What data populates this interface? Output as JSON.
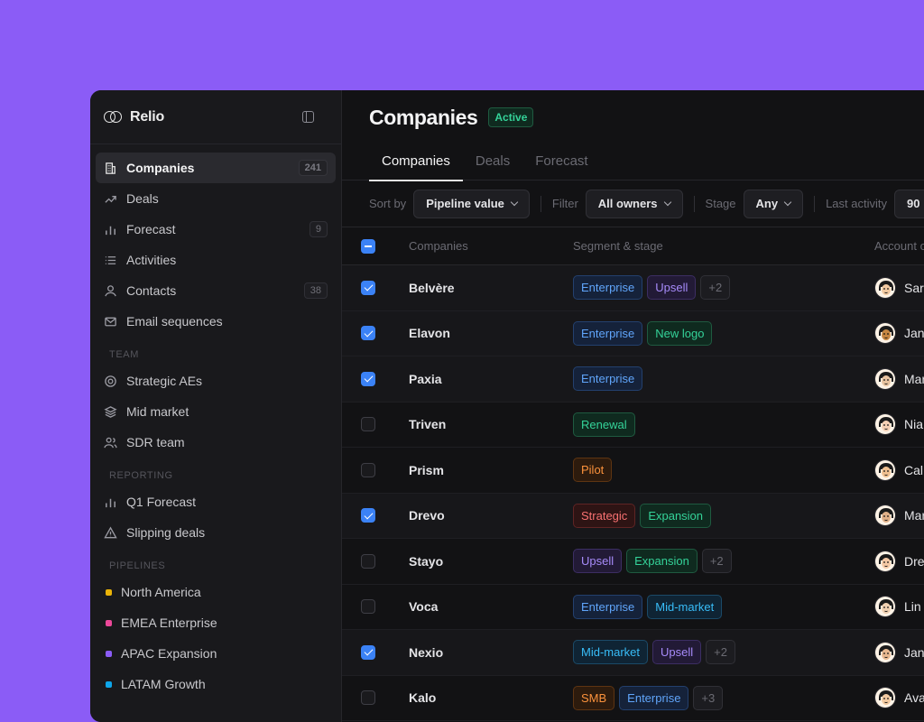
{
  "app": {
    "name": "Relio"
  },
  "sidebar": {
    "items": [
      {
        "label": "Companies",
        "badge": "241",
        "icon": "building-icon",
        "active": true
      },
      {
        "label": "Deals",
        "badge": "",
        "icon": "trend-icon"
      },
      {
        "label": "Forecast",
        "badge": "9",
        "icon": "bar-chart-icon"
      },
      {
        "label": "Activities",
        "badge": "",
        "icon": "list-icon"
      },
      {
        "label": "Contacts",
        "badge": "38",
        "icon": "user-icon"
      },
      {
        "label": "Email sequences",
        "badge": "",
        "icon": "mail-icon"
      }
    ],
    "team_label": "TEAM",
    "team": [
      {
        "label": "Strategic AEs",
        "icon": "target-icon"
      },
      {
        "label": "Mid market",
        "icon": "layers-icon"
      },
      {
        "label": "SDR team",
        "icon": "users-icon"
      }
    ],
    "reporting_label": "REPORTING",
    "reporting": [
      {
        "label": "Q1 Forecast",
        "icon": "bar-chart-icon"
      },
      {
        "label": "Slipping deals",
        "icon": "warning-icon"
      }
    ],
    "pipelines_label": "PIPELINES",
    "pipelines": [
      {
        "label": "North America",
        "color": "#eab308"
      },
      {
        "label": "EMEA Enterprise",
        "color": "#ec4899"
      },
      {
        "label": "APAC Expansion",
        "color": "#8b5cf6"
      },
      {
        "label": "LATAM Growth",
        "color": "#0ea5e9"
      }
    ]
  },
  "header": {
    "title": "Companies",
    "status": "Active"
  },
  "tabs": [
    "Companies",
    "Deals",
    "Forecast"
  ],
  "filters": {
    "sort_label": "Sort by",
    "sort_value": "Pipeline value",
    "filter_label": "Filter",
    "filter_value": "All owners",
    "stage_label": "Stage",
    "stage_value": "Any",
    "activity_label": "Last activity",
    "activity_value": "90"
  },
  "table": {
    "columns": [
      "Companies",
      "Segment & stage",
      "Account o"
    ],
    "rows": [
      {
        "name": "Belvère",
        "checked": true,
        "tags": [
          [
            "Enterprise",
            "blue"
          ],
          [
            "Upsell",
            "purple"
          ],
          [
            "+2",
            "more"
          ]
        ],
        "owner": "Sar",
        "skin": "#f2c9a0"
      },
      {
        "name": "Elavon",
        "checked": true,
        "tags": [
          [
            "Enterprise",
            "blue"
          ],
          [
            "New logo",
            "green"
          ]
        ],
        "owner": "Jan",
        "skin": "#c68642"
      },
      {
        "name": "Paxia",
        "checked": true,
        "tags": [
          [
            "Enterprise",
            "blue"
          ]
        ],
        "owner": "Mar",
        "skin": "#e8c3a0"
      },
      {
        "name": "Triven",
        "checked": false,
        "tags": [
          [
            "Renewal",
            "green"
          ]
        ],
        "owner": "Nia",
        "skin": "#f5d0b5"
      },
      {
        "name": "Prism",
        "checked": false,
        "tags": [
          [
            "Pilot",
            "orange"
          ]
        ],
        "owner": "Cal",
        "skin": "#f0c090"
      },
      {
        "name": "Drevo",
        "checked": true,
        "tags": [
          [
            "Strategic",
            "red"
          ],
          [
            "Expansion",
            "green"
          ]
        ],
        "owner": "Mar",
        "skin": "#e0b088"
      },
      {
        "name": "Stayo",
        "checked": false,
        "tags": [
          [
            "Upsell",
            "purple"
          ],
          [
            "Expansion",
            "green"
          ],
          [
            "+2",
            "more"
          ]
        ],
        "owner": "Dre",
        "skin": "#f5c9a5"
      },
      {
        "name": "Voca",
        "checked": false,
        "tags": [
          [
            "Enterprise",
            "blue"
          ],
          [
            "Mid-market",
            "cyan"
          ]
        ],
        "owner": "Lin",
        "skin": "#f0d0b0"
      },
      {
        "name": "Nexio",
        "checked": true,
        "tags": [
          [
            "Mid-market",
            "cyan"
          ],
          [
            "Upsell",
            "purple"
          ],
          [
            "+2",
            "more"
          ]
        ],
        "owner": "Jan",
        "skin": "#e8b890"
      },
      {
        "name": "Kalo",
        "checked": false,
        "tags": [
          [
            "SMB",
            "orange"
          ],
          [
            "Enterprise",
            "blue"
          ],
          [
            "+3",
            "more"
          ]
        ],
        "owner": "Ava",
        "skin": "#f2c9a0"
      }
    ]
  }
}
